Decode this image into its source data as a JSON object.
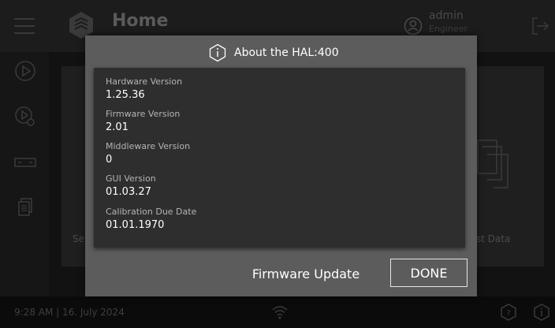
{
  "header": {
    "title": "Home",
    "user_name": "admin",
    "user_role": "Engineer"
  },
  "background_tiles": {
    "left_label": "Se",
    "right_label": "st Data"
  },
  "footer": {
    "datetime": "9:28 AM | 16. July 2024"
  },
  "modal": {
    "title": "About the HAL:400",
    "fields": [
      {
        "label": "Hardware Version",
        "value": "1.25.36"
      },
      {
        "label": "Firmware Version",
        "value": "2.01"
      },
      {
        "label": "Middleware Version",
        "value": "0"
      },
      {
        "label": "GUI Version",
        "value": "01.03.27"
      },
      {
        "label": "Calibration Due Date",
        "value": "01.01.1970"
      }
    ],
    "firmware_update_label": "Firmware Update",
    "done_label": "DONE"
  },
  "icons": {
    "menu": "hamburger-icon",
    "logo": "hexagon-logo",
    "user": "user-icon",
    "logout": "logout-icon",
    "sidebar": [
      "play-icon",
      "play-settings-icon",
      "device-icon",
      "documents-icon"
    ],
    "wifi": "wifi-icon",
    "help": "help-icon",
    "info": "info-icon"
  },
  "colors": {
    "modal_bg": "#5c5c5c",
    "panel_bg": "#2e2e2e",
    "text": "#ffffff"
  }
}
